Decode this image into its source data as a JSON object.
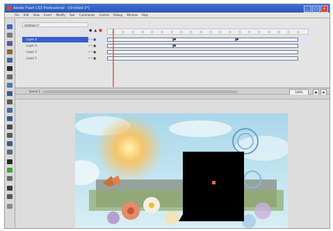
{
  "window": {
    "title": "Adobe Flash CS3 Professional - [Untitled-1*]"
  },
  "menu": [
    "File",
    "Edit",
    "View",
    "Insert",
    "Modify",
    "Text",
    "Commands",
    "Control",
    "Debug",
    "Window",
    "Help"
  ],
  "timeline": {
    "tab_label": "Untitled-1*",
    "header_icons": [
      "eye-icon",
      "lock-icon",
      "outline-icon"
    ],
    "layers": [
      {
        "name": "Layer 4",
        "selected": true
      },
      {
        "name": "Layer 3"
      },
      {
        "name": "Layer 2"
      },
      {
        "name": "Layer 1"
      }
    ]
  },
  "stage": {
    "scene_label": "Scene 1",
    "zoom_value": "100%"
  },
  "colors": {
    "titlebar": "#2a56b8",
    "selected_layer": "#3a5fcd",
    "playhead": "#e05a4a"
  }
}
